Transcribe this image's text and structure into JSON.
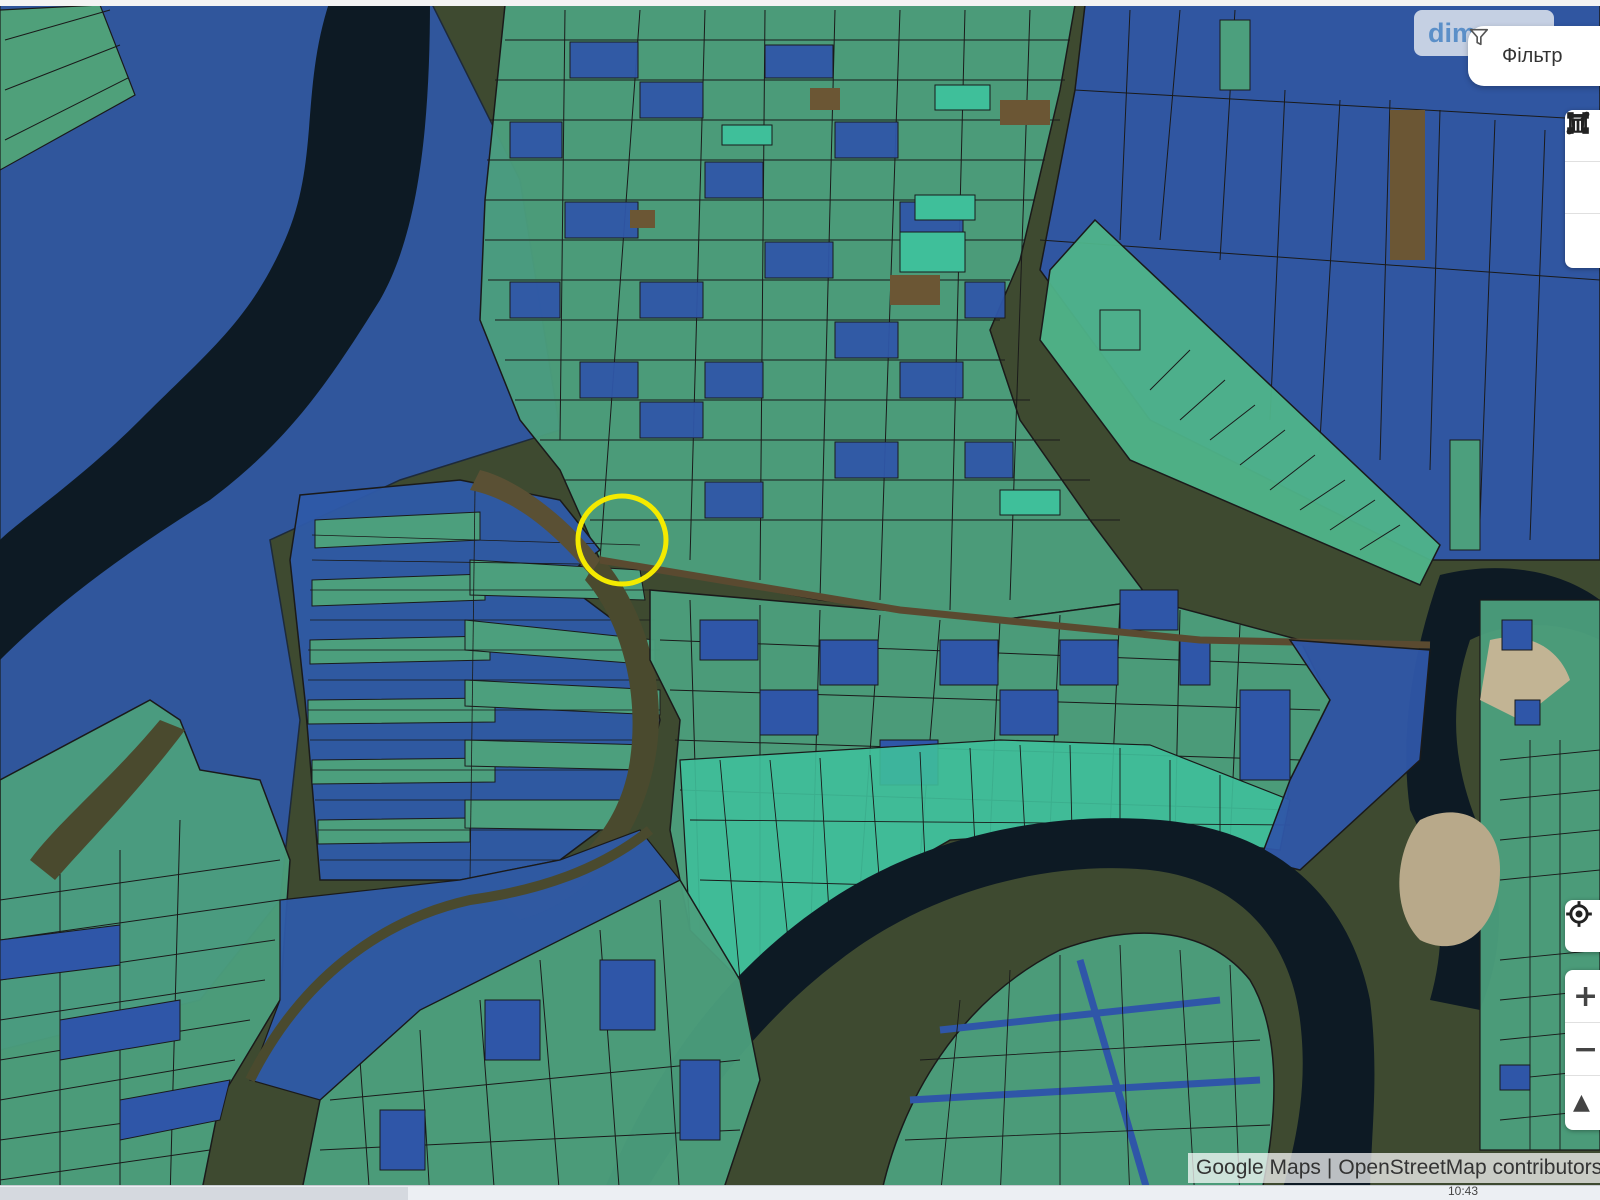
{
  "watermark": "dim",
  "toolbar": {
    "filter_label": "Фільтр",
    "icons": [
      "filter-icon",
      "draw-polyline-icon",
      "draw-rectangle-icon",
      "delete-trash-icon",
      "locate-icon"
    ]
  },
  "zoom": {
    "in_label": "+",
    "out_label": "−",
    "north_label": "▲"
  },
  "attribution": {
    "google": "Google Maps",
    "separator": "|",
    "osm": "OpenStreetMap contributors"
  },
  "status": {
    "time": "10:43"
  },
  "map": {
    "basemap": "satellite",
    "overlay": "cadastral land parcels",
    "marker": "yellow circle",
    "colors": {
      "river": "#0d1a24",
      "parcel_green": "#4fa07a",
      "parcel_teal": "#3fbf9a",
      "parcel_blue": "#2f56a8",
      "parcel_outline": "#1a1a1a",
      "marker": "#f4ea00"
    }
  }
}
